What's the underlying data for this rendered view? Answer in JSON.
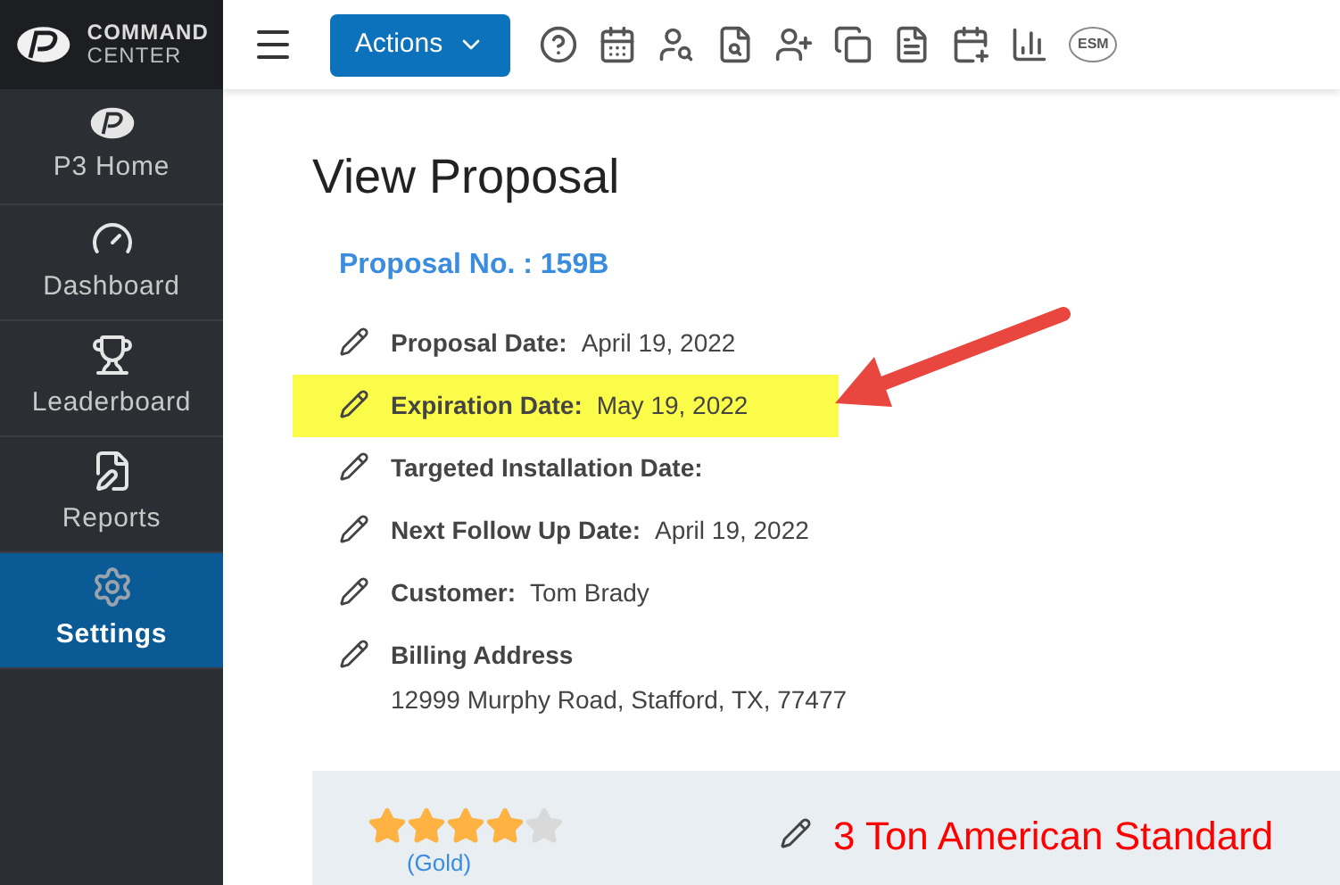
{
  "logo": {
    "line_1": "COMMAND",
    "line_2": "CENTER"
  },
  "sidebar": {
    "items": [
      {
        "label": "P3 Home",
        "kind": "home",
        "selected": false
      },
      {
        "label": "Dashboard",
        "kind": "dashboard",
        "selected": false
      },
      {
        "label": "Leaderboard",
        "kind": "leaderboard",
        "selected": false
      },
      {
        "label": "Reports",
        "kind": "reports",
        "selected": false
      },
      {
        "label": "Settings",
        "kind": "settings",
        "selected": true
      }
    ]
  },
  "toolbar": {
    "actions_button": "Actions",
    "esm_badge": "ESM"
  },
  "page_title": "View Proposal",
  "proposal_number": "Proposal No. : 159B",
  "fields": [
    {
      "label": "Proposal Date:",
      "value": "April 19, 2022",
      "highlighted": false
    },
    {
      "label": "Expiration Date:",
      "value": "May 19, 2022",
      "highlighted": true
    },
    {
      "label": "Targeted Installation Date:",
      "highlighted": false
    },
    {
      "label": "Next Follow Up Date:",
      "value": "April 19, 2022",
      "highlighted": false
    },
    {
      "label": "Customer:",
      "value": "Tom Brady",
      "highlighted": false
    },
    {
      "label": "Billing Address",
      "value": "12999 Murphy Road, Stafford, TX, 77477",
      "highlighted": false,
      "kind": "block"
    }
  ],
  "option_card": {
    "stars": 4,
    "tier": "(Gold)",
    "title": "3 Ton American Standard"
  }
}
